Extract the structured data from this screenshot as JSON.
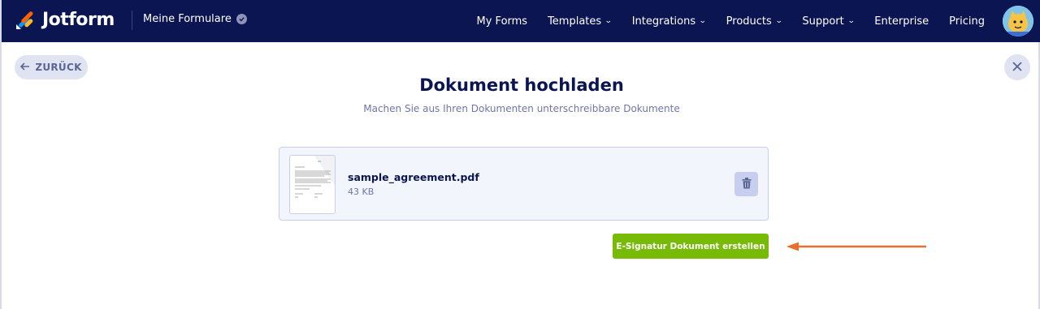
{
  "header": {
    "logo_text": "Jotform",
    "workspace_label": "Meine Formulare",
    "nav": [
      {
        "label": "My Forms",
        "dropdown": false
      },
      {
        "label": "Templates",
        "dropdown": true
      },
      {
        "label": "Integrations",
        "dropdown": true
      },
      {
        "label": "Products",
        "dropdown": true
      },
      {
        "label": "Support",
        "dropdown": true
      },
      {
        "label": "Enterprise",
        "dropdown": false
      },
      {
        "label": "Pricing",
        "dropdown": false
      }
    ],
    "chevron_glyph": "⌄"
  },
  "page": {
    "back_label": "ZURÜCK",
    "title": "Dokument hochladen",
    "subtitle": "Machen Sie aus Ihren Dokumenten unterschreibbare Dokumente"
  },
  "file": {
    "name": "sample_agreement.pdf",
    "size": "43 KB"
  },
  "actions": {
    "create_label": "E-Signatur Dokument erstellen"
  },
  "colors": {
    "header_bg": "#0a1551",
    "accent_green": "#78bb07",
    "annotation_arrow": "#e8702a",
    "card_bg": "#f3f5fd"
  },
  "icons": [
    "logo-icon",
    "verified-icon",
    "chevron-down-icon",
    "avatar",
    "arrow-left-icon",
    "close-icon",
    "document-thumbnail",
    "trash-icon",
    "annotation-arrow"
  ]
}
